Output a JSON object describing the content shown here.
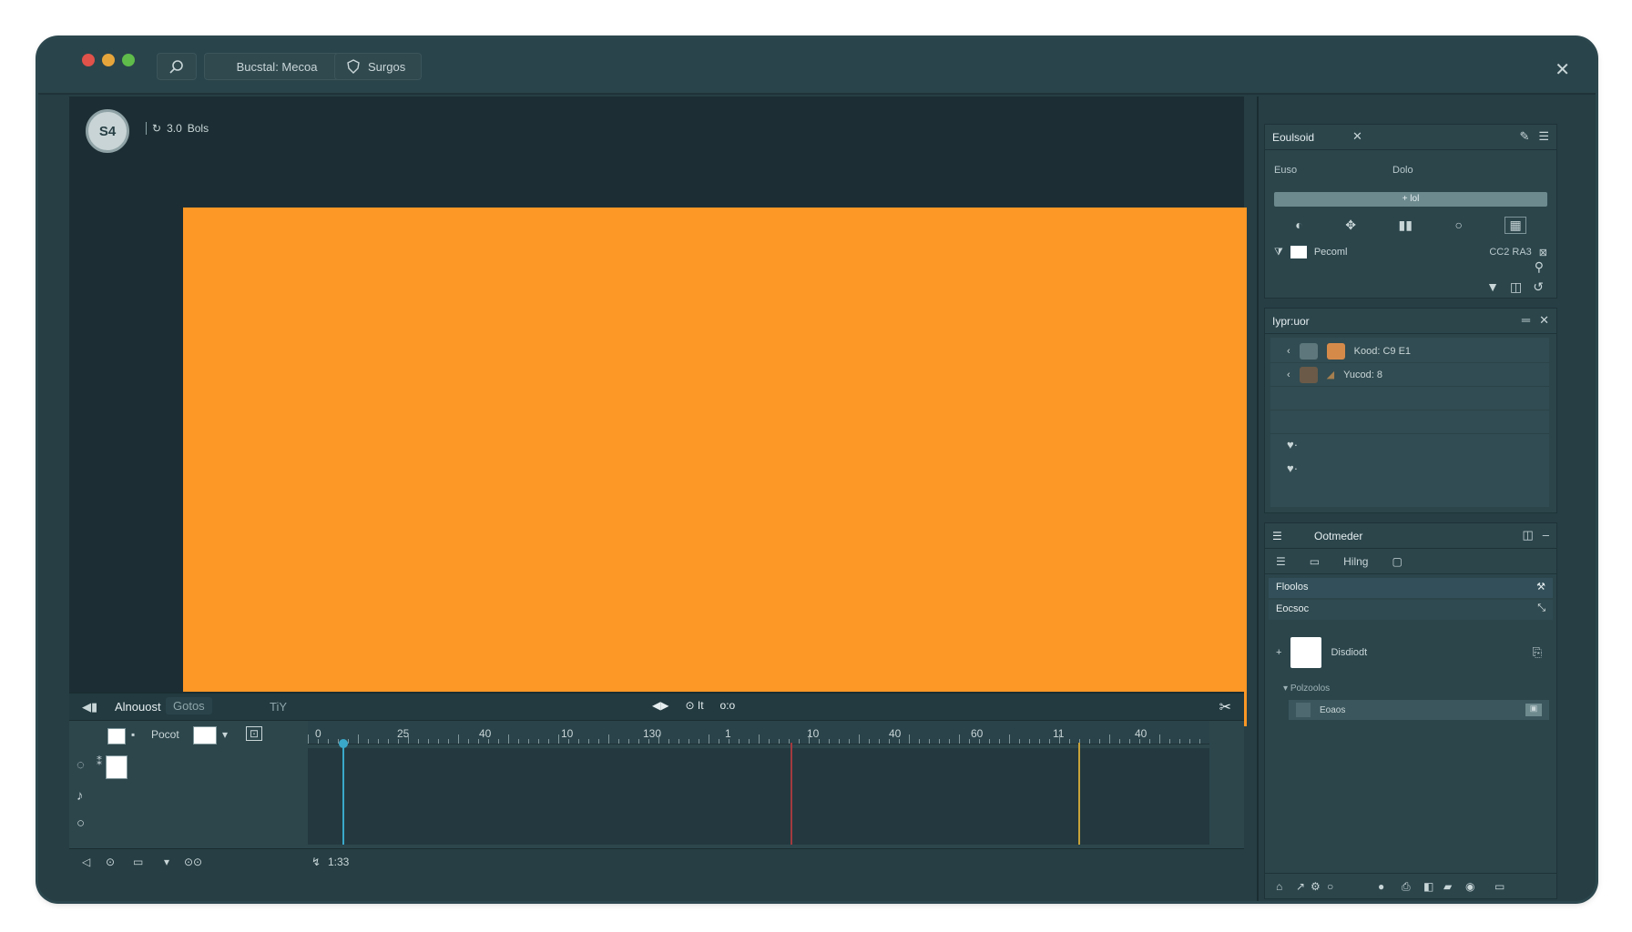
{
  "window": {
    "search_icon": "search-icon",
    "doc_title": "Bucstal: Mecoa",
    "settings_label": "Surgos",
    "close_glyph": "✕"
  },
  "canvas": {
    "logo_text": "S4",
    "zoom_label": "3.0",
    "zoom_unit": "Bols",
    "artboard_color": "#fd9726"
  },
  "timeline": {
    "tabs": [
      "Alnouost",
      "Gotos",
      "TiY"
    ],
    "controls": [
      "◀▶",
      "⊙ It",
      "o:o"
    ],
    "track_label": "Pocot",
    "ruler_labels": [
      "0",
      "25",
      "40",
      "10",
      "130",
      "1",
      "10",
      "40",
      "60",
      "11",
      "40"
    ],
    "footer": [
      "◁",
      "⊙",
      "▭",
      "▾",
      "⊙⊙",
      "↯",
      "1:33"
    ]
  },
  "panel_edit": {
    "title": "Eoulsoid",
    "label_left": "Euso",
    "label_right": "Dolo",
    "slider_text": "+ lol",
    "layer_name": "Pecoml",
    "layer_value": "CC2 RA3"
  },
  "panel_layers": {
    "title": "Iypr:uor",
    "items": [
      {
        "label": "Kood: C9 E1",
        "color": "#d68a4a"
      },
      {
        "label": "Yucod: 8",
        "color": "#a57f4f"
      }
    ]
  },
  "panel_content": {
    "title": "Ootmeder",
    "tab_active": "Hilng",
    "section1": "Floolos",
    "section2": "Eocsoc",
    "item_label": "Disdiodt",
    "group_label": "Polzoolos",
    "group_item": "Eoaos"
  }
}
